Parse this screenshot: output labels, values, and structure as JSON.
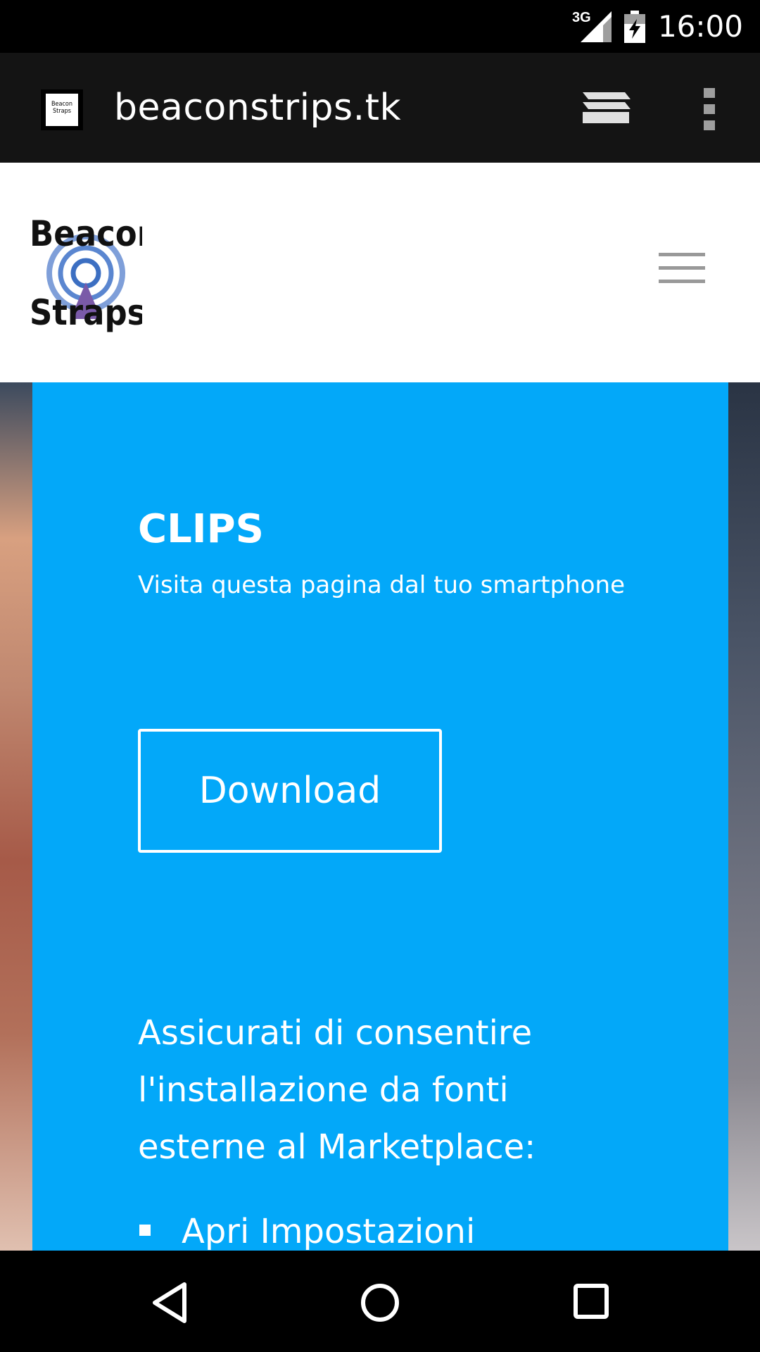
{
  "status_bar": {
    "network": "3G",
    "time": "16:00",
    "icons": [
      "signal-icon",
      "battery-charging-icon"
    ]
  },
  "browser": {
    "url": "beaconstrips.tk",
    "favicon_text": [
      "Beacon",
      "Straps"
    ],
    "icons": [
      "tabs-icon",
      "overflow-menu-icon"
    ]
  },
  "site": {
    "logo_text": [
      "Beacon",
      "Straps"
    ],
    "menu_icon": "hamburger-icon"
  },
  "card": {
    "title": "CLIPS",
    "subtitle": "Visita questa pagina dal tuo smartphone",
    "download_label": "Download",
    "instructions": "Assicurati di consentire l'installazione da fonti esterne al Marketplace:",
    "steps": [
      "Apri Impostazioni"
    ]
  },
  "colors": {
    "card_blue": "#03a8f9",
    "toolbar": "#141414"
  },
  "nav": {
    "icons": [
      "back-icon",
      "home-icon",
      "recents-icon"
    ]
  }
}
